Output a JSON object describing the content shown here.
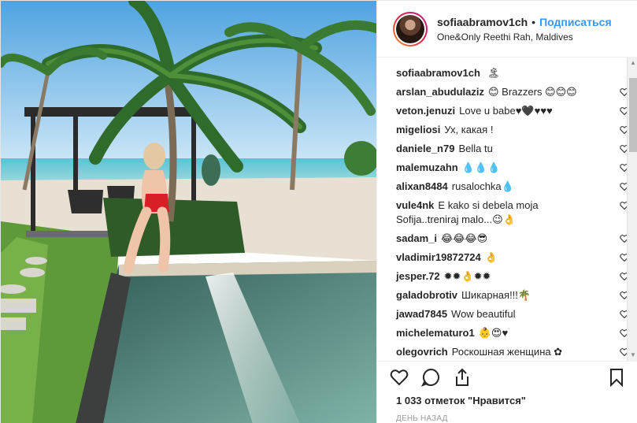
{
  "post": {
    "author": "sofiaabramov1ch",
    "separator": "•",
    "follow_label": "Подписаться",
    "location": "One&Only Reethi Rah, Maldives",
    "caption": "🏝"
  },
  "comments": [
    {
      "user": "arslan_abudulaziz",
      "text": "😊 Brazzers 😊😊😊"
    },
    {
      "user": "veton.jenuzi",
      "text": "Love u babe♥🖤♥♥♥"
    },
    {
      "user": "migeliosi",
      "text": "Ух, какая !"
    },
    {
      "user": "daniele_n79",
      "text": "Bella tu"
    },
    {
      "user": "malemuzahn",
      "text": "💧💧💧"
    },
    {
      "user": "alixan8484",
      "text": "rusalochka💧"
    },
    {
      "user": "vule4nk",
      "text": "E kako si debela moja Sofija..treniraj malo...😉👌"
    },
    {
      "user": "sadam_i",
      "text": "😂😂😂😎"
    },
    {
      "user": "vladimir19872724",
      "text": "👌"
    },
    {
      "user": "jesper.72",
      "text": "✹✹👌✹✹"
    },
    {
      "user": "galadobrotiv",
      "text": "Шикарная!!!🌴"
    },
    {
      "user": "jawad7845",
      "text": "Wow beautiful"
    },
    {
      "user": "michelematuro1",
      "text": "👶😍♥"
    },
    {
      "user": "olegovrich",
      "text": "Роскошная женщина ✿"
    }
  ],
  "likes": "1 033 отметок \"Нравится\"",
  "timestamp": "ДЕНЬ НАЗАД",
  "icons": [
    "heart-icon",
    "comment-icon",
    "share-icon",
    "bookmark-icon"
  ],
  "colors": {
    "follow": "#3897f0",
    "text": "#262626",
    "muted": "#999999"
  }
}
